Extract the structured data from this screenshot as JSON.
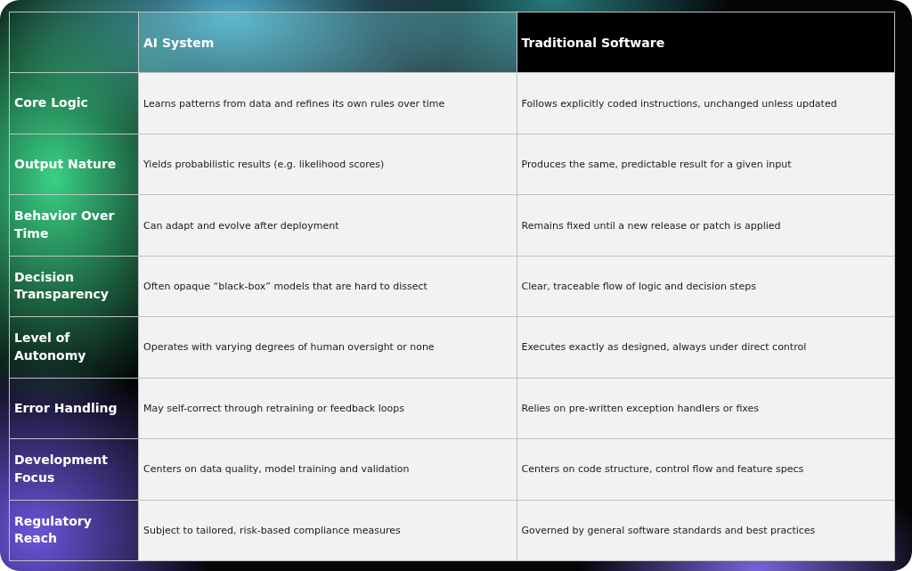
{
  "table": {
    "columns": [
      "AI System",
      "Traditional Software"
    ],
    "rows": [
      {
        "label": "Core Logic",
        "cells": [
          "Learns patterns from data and refines its own rules over time",
          "Follows explicitly coded instructions, unchanged unless updated"
        ]
      },
      {
        "label": "Output Nature",
        "cells": [
          "Yields probabilistic results (e.g. likelihood scores)",
          "Produces the same, predictable result for a given input"
        ]
      },
      {
        "label": "Behavior Over Time",
        "cells": [
          "Can adapt and evolve after deployment",
          "Remains fixed until a new release or patch is applied"
        ]
      },
      {
        "label": "Decision Transparency",
        "cells": [
          "Often opaque “black-box” models that are hard to dissect",
          "Clear, traceable flow of logic and decision steps"
        ]
      },
      {
        "label": "Level of Autonomy",
        "cells": [
          "Operates with varying degrees of human oversight or none",
          "Executes exactly as designed, always under direct control"
        ]
      },
      {
        "label": "Error Handling",
        "cells": [
          "May self-correct through retraining or feedback loops",
          "Relies on pre-written exception handlers or fixes"
        ]
      },
      {
        "label": "Development Focus",
        "cells": [
          "Centers on data quality, model training and validation",
          "Centers on code structure, control flow and feature specs"
        ]
      },
      {
        "label": "Regulatory Reach",
        "cells": [
          "Subject to tailored, risk-based compliance measures",
          "Governed by general software standards and best practices"
        ]
      }
    ]
  }
}
